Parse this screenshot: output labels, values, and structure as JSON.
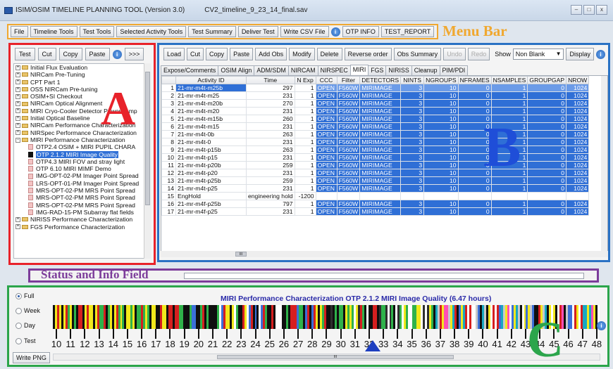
{
  "window": {
    "title": "ISIM/OSIM TIMELINE PLANNING TOOL  (Version 3.0)",
    "file": "CV2_timeline_9_23_14_final.sav",
    "controls": [
      "–",
      "□",
      "x"
    ]
  },
  "menubar": {
    "items": [
      "File",
      "Timeline Tools",
      "Test Tools",
      "Selected Activity Tools",
      "Test Summary",
      "Deliver Test",
      "Write CSV File",
      "OTP INFO",
      "TEST_REPORT"
    ],
    "info_icon": "i",
    "annotation": "Menu Bar"
  },
  "panel_a": {
    "annotation": "A",
    "toolbar": [
      "Test",
      "Cut",
      "Copy",
      "Paste",
      ">>>"
    ],
    "info_icon": "i",
    "tree": [
      {
        "label": "Initial Flux Evaluation",
        "kind": "folder",
        "expander": "+"
      },
      {
        "label": "NIRCam Pre-Tuning",
        "kind": "folder",
        "expander": "+"
      },
      {
        "label": "CPT Part 1",
        "kind": "folder",
        "expander": "+"
      },
      {
        "label": "OSS NIRCam Pre-tuning",
        "kind": "folder",
        "expander": "+"
      },
      {
        "label": "OSIM+SI Checkout",
        "kind": "folder",
        "expander": "+"
      },
      {
        "label": "NIRCam Optical Alignment",
        "kind": "folder",
        "expander": "+"
      },
      {
        "label": "MIRI Cryo-Cooler Detector Power Temp",
        "kind": "folder",
        "expander": "+"
      },
      {
        "label": "Initial Optical Baseline",
        "kind": "folder",
        "expander": "+"
      },
      {
        "label": "NIRCam Performance Characterization",
        "kind": "folder",
        "expander": "+"
      },
      {
        "label": "NIRSpec Performance Characterization",
        "kind": "folder",
        "expander": "+"
      },
      {
        "label": "MIRI Performance Characterization",
        "kind": "folder",
        "expander": "−"
      },
      {
        "label": "OTP2.4 OSIM + MIRI PUPIL CHARA",
        "kind": "doc",
        "indent": 1
      },
      {
        "label": "OTP 2.1.2 MIRI Image Quality",
        "kind": "doc",
        "indent": 1,
        "selected": true
      },
      {
        "label": "OTP4.3 MIRI FOV and stray light",
        "kind": "doc",
        "indent": 1
      },
      {
        "label": "OTP 6.10 MIRI MIMF Demo",
        "kind": "doc",
        "indent": 1
      },
      {
        "label": "IMG-OPT-02-PM Imager Point Spread",
        "kind": "doc",
        "indent": 1
      },
      {
        "label": "LRS-OPT-01-PM Imager Point Spread",
        "kind": "doc",
        "indent": 1
      },
      {
        "label": "MRS-OPT-02-PM MRS Point Spread",
        "kind": "doc",
        "indent": 1
      },
      {
        "label": "MRS-OPT-02-PM MRS Point Spread",
        "kind": "doc",
        "indent": 1
      },
      {
        "label": "MRS-OPT-02-PM MRS Point Spread",
        "kind": "doc",
        "indent": 1
      },
      {
        "label": "IMG-RAD-15-PM Subarray flat fields",
        "kind": "doc",
        "indent": 1
      },
      {
        "label": "NIRISS Performance Characterization",
        "kind": "folder",
        "expander": "+"
      },
      {
        "label": "FGS Performance Characterization",
        "kind": "folder",
        "expander": "+"
      }
    ]
  },
  "panel_b": {
    "annotation": "B",
    "toolbar": [
      "Load",
      "Cut",
      "Copy",
      "Paste",
      "Add Obs",
      "Modify",
      "Delete",
      "Reverse order",
      "Obs Summary",
      "Undo",
      "Redo"
    ],
    "disabled": [
      "Undo",
      "Redo"
    ],
    "show_label": "Show",
    "show_value": "Non Blank",
    "display_button": "Display",
    "info_icon": "i",
    "tabs": [
      "Expose/Comments",
      "OSIM Align",
      "ADM/SDM",
      "NIRCAM",
      "NIRSPEC",
      "MIRI",
      "FGS",
      "NIRISS",
      "Cleanup",
      "PIM/PDI"
    ],
    "active_tab": "MIRI",
    "columns": [
      "",
      "Activity ID",
      "Time",
      "N Exp",
      "CCC",
      "Filter",
      "DETECTORS",
      "NINTS",
      "NGROUPS",
      "NFRAMES",
      "NSAMPLES",
      "GROUPGAP",
      "NROW"
    ],
    "rows": [
      [
        "1",
        "21-mr-m4t-m25b",
        "297",
        "1",
        "OPEN",
        "F560W",
        "MIRIMAGE",
        "3",
        "10",
        "0",
        "1",
        "0",
        "1024"
      ],
      [
        "2",
        "21-mr-m4t-m25",
        "231",
        "1",
        "OPEN",
        "F560W",
        "MIRIMAGE",
        "3",
        "10",
        "0",
        "1",
        "0",
        "1024"
      ],
      [
        "3",
        "21-mr-m4t-m20b",
        "270",
        "1",
        "OPEN",
        "F560W",
        "MIRIMAGE",
        "3",
        "10",
        "0",
        "1",
        "0",
        "1024"
      ],
      [
        "4",
        "21-mr-m4t-m20",
        "231",
        "1",
        "OPEN",
        "F560W",
        "MIRIMAGE",
        "3",
        "10",
        "0",
        "1",
        "0",
        "1024"
      ],
      [
        "5",
        "21-mr-m4t-m15b",
        "260",
        "1",
        "OPEN",
        "F560W",
        "MIRIMAGE",
        "3",
        "10",
        "0",
        "1",
        "0",
        "1024"
      ],
      [
        "6",
        "21-mr-m4t-m15",
        "231",
        "1",
        "OPEN",
        "F560W",
        "MIRIMAGE",
        "3",
        "10",
        "0",
        "1",
        "0",
        "1024"
      ],
      [
        "7",
        "21-mr-m4t-0b",
        "263",
        "1",
        "OPEN",
        "F560W",
        "MIRIMAGE",
        "3",
        "10",
        "0",
        "1",
        "0",
        "1024"
      ],
      [
        "8",
        "21-mr-m4t-0",
        "231",
        "1",
        "OPEN",
        "F560W",
        "MIRIMAGE",
        "3",
        "10",
        "0",
        "1",
        "0",
        "1024"
      ],
      [
        "9",
        "21-mr-m4t-p15b",
        "263",
        "1",
        "OPEN",
        "F560W",
        "MIRIMAGE",
        "3",
        "10",
        "0",
        "1",
        "0",
        "1024"
      ],
      [
        "10",
        "21-mr-m4t-p15",
        "231",
        "1",
        "OPEN",
        "F560W",
        "MIRIMAGE",
        "3",
        "10",
        "0",
        "1",
        "0",
        "1024"
      ],
      [
        "11",
        "21-mr-m4t-p20b",
        "259",
        "1",
        "OPEN",
        "F560W",
        "MIRIMAGE",
        "3",
        "10",
        "0",
        "1",
        "0",
        "1024"
      ],
      [
        "12",
        "21-mr-m4t-p20",
        "231",
        "1",
        "OPEN",
        "F560W",
        "MIRIMAGE",
        "3",
        "10",
        "0",
        "1",
        "0",
        "1024"
      ],
      [
        "13",
        "21-mr-m4t-p25b",
        "259",
        "1",
        "OPEN",
        "F560W",
        "MIRIMAGE",
        "3",
        "10",
        "0",
        "1",
        "0",
        "1024"
      ],
      [
        "14",
        "21-mr-m4t-p25",
        "231",
        "1",
        "OPEN",
        "F560W",
        "MIRIMAGE",
        "3",
        "10",
        "0",
        "1",
        "0",
        "1024"
      ],
      [
        "15",
        "EngHold",
        "engineering hold",
        "-1200",
        "",
        "",
        "",
        "",
        "",
        "",
        "",
        "",
        ""
      ],
      [
        "16",
        "21-mr-m4f-p25b",
        "797",
        "1",
        "OPEN",
        "F560W",
        "MIRIMAGE",
        "3",
        "10",
        "0",
        "1",
        "0",
        "1024"
      ],
      [
        "17",
        "21-mr-m4f-p25",
        "231",
        "1",
        "OPEN",
        "F560W",
        "MIRIMAGE",
        "3",
        "10",
        "0",
        "1",
        "0",
        "1024"
      ]
    ],
    "scroll_mark": "III"
  },
  "status": {
    "annotation": "Status and Info Field",
    "text": ""
  },
  "panel_c": {
    "annotation": "C",
    "radios": [
      "Full",
      "Week",
      "Day",
      "Test"
    ],
    "selected_radio": "Full",
    "title": "MIRI Performance Characterization  OTP 2.1.2 MIRI Image Quality (6.47 hours)",
    "axis_labels": [
      "10",
      "11",
      "12",
      "13",
      "14",
      "15",
      "16",
      "17",
      "18",
      "19",
      "20",
      "21",
      "22",
      "23",
      "24",
      "25",
      "26",
      "27",
      "28",
      "29",
      "30",
      "31",
      "32",
      "33",
      "34",
      "35",
      "36",
      "37",
      "38",
      "39",
      "40",
      "41",
      "42",
      "43",
      "44",
      "45",
      "46",
      "47",
      "48"
    ],
    "write_png": "Write PNG",
    "scroll_mark": "III",
    "info_icon": "i"
  }
}
